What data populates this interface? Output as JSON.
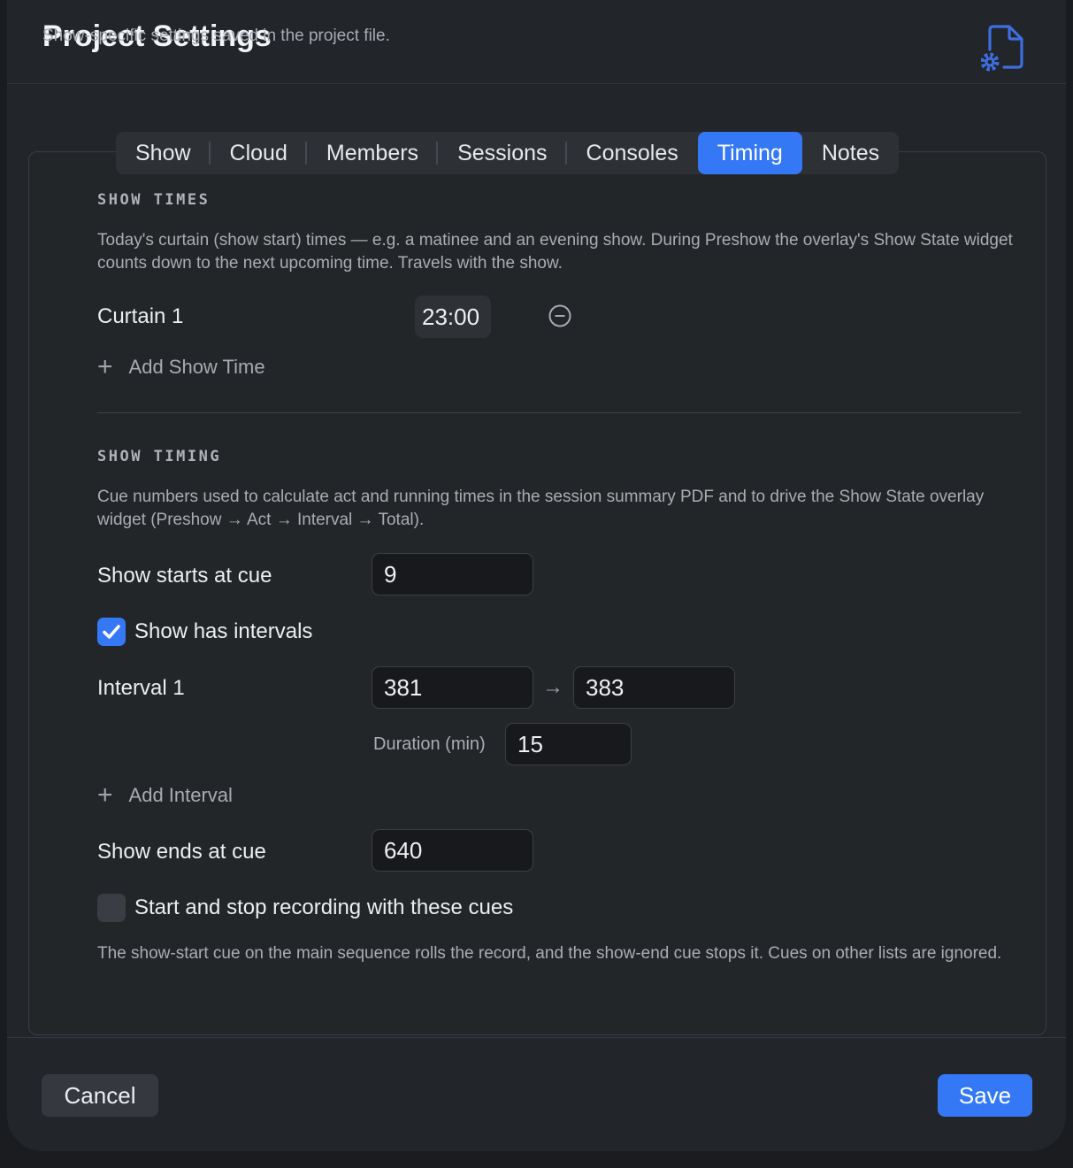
{
  "header": {
    "title": "Project Settings",
    "subtitle": "Show-specific settings saved in the project file."
  },
  "tabs": [
    {
      "label": "Show"
    },
    {
      "label": "Cloud"
    },
    {
      "label": "Members"
    },
    {
      "label": "Sessions"
    },
    {
      "label": "Consoles"
    },
    {
      "label": "Timing",
      "active": true
    },
    {
      "label": "Notes"
    }
  ],
  "show_times": {
    "title": "SHOW TIMES",
    "description": "Today's curtain (show start) times — e.g. a matinee and an evening show. During Preshow the overlay's Show State widget counts down to the next upcoming time. Travels with the show.",
    "curtain_label": "Curtain 1",
    "curtain_time": "23:00",
    "add_label": "Add Show Time"
  },
  "show_timing": {
    "title": "SHOW TIMING",
    "description": "Cue numbers used to calculate act and running times in the session summary PDF and to drive the Show State overlay widget (Preshow → Act → Interval → Total).",
    "starts_label": "Show starts at cue",
    "starts_value": "9",
    "has_intervals_label": "Show has intervals",
    "has_intervals_checked": true,
    "interval_label": "Interval 1",
    "interval_from": "381",
    "interval_arrow": "→",
    "interval_to": "383",
    "duration_label": "Duration (min)",
    "duration_value": "15",
    "add_interval_label": "Add Interval",
    "ends_label": "Show ends at cue",
    "ends_value": "640",
    "record_label": "Start and stop recording with these cues",
    "record_checked": false,
    "record_note": "The show-start cue on the main sequence rolls the record, and the show-end cue stops it. Cues on other lists are ignored."
  },
  "footer": {
    "cancel_label": "Cancel",
    "save_label": "Save"
  },
  "colors": {
    "accent": "#3478f6",
    "background": "#222529",
    "field": "#18191c"
  }
}
